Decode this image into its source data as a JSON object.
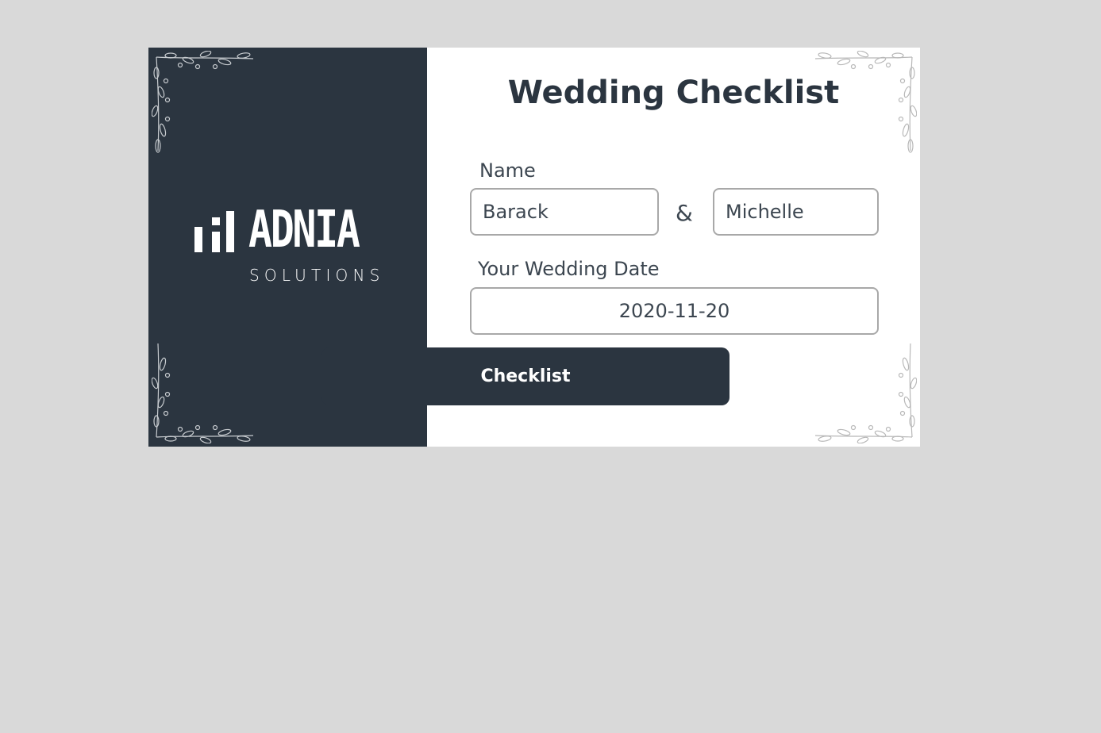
{
  "branding": {
    "logo_word": "ADNIA",
    "logo_sub": "SOLUTIONS"
  },
  "form": {
    "title": "Wedding Checklist",
    "name_label": "Name",
    "name_first_value": "Barack",
    "separator": "&",
    "name_second_value": "Michelle",
    "date_label": "Your Wedding Date",
    "date_value": "2020-11-20",
    "submit_label": "Checklist"
  },
  "icons": {
    "corner_ornament": "floral-vine-icon",
    "logo_mark": "bars-logo-icon"
  },
  "colors": {
    "page_background": "#d9d9d9",
    "panel_dark": "#2b3540",
    "panel_light": "#ffffff",
    "input_border": "#a8a8a8",
    "text": "#3c4650"
  }
}
